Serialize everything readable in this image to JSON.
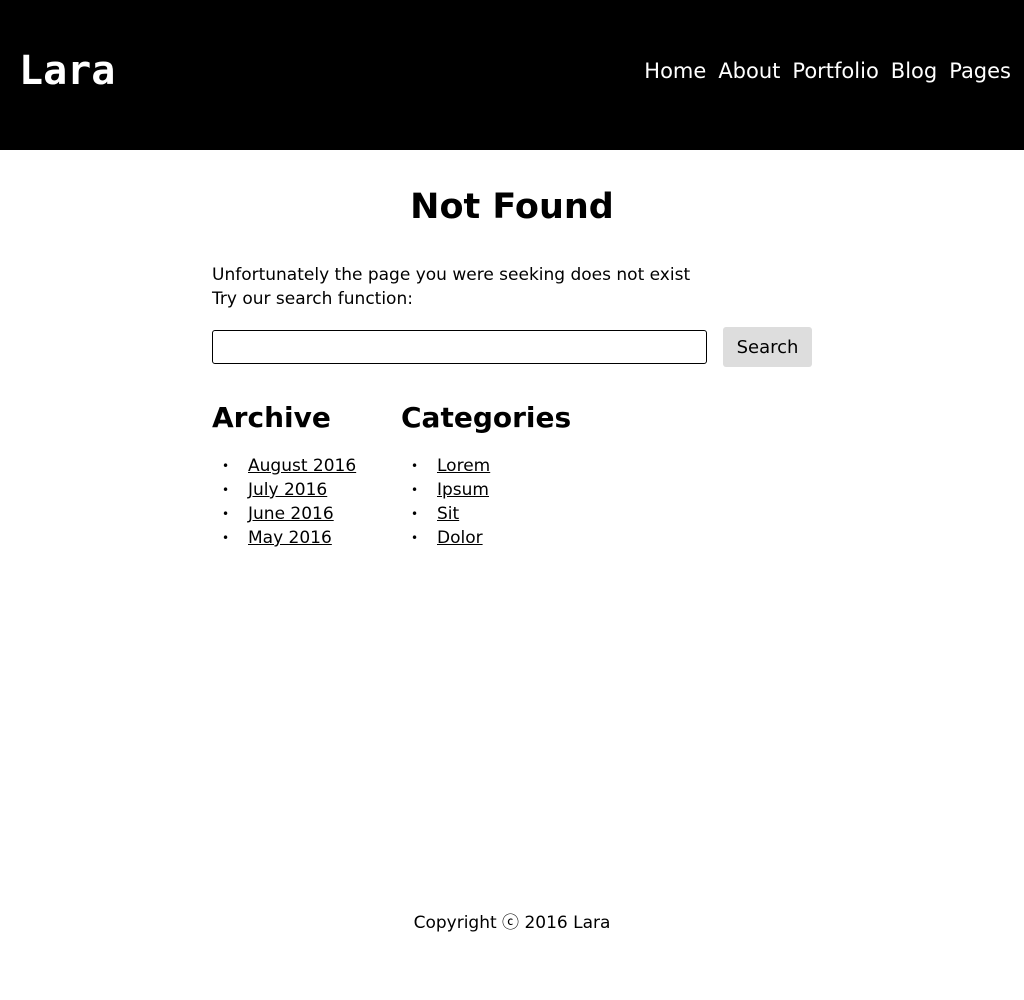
{
  "header": {
    "logo": "Lara",
    "nav": [
      "Home",
      "About",
      "Portfolio",
      "Blog",
      "Pages"
    ]
  },
  "main": {
    "title": "Not Found",
    "message_line1": "Unfortunately the page you were seeking does not exist",
    "message_line2": "Try our search function:",
    "search": {
      "value": "",
      "placeholder": "",
      "button_label": "Search"
    }
  },
  "archive": {
    "heading": "Archive",
    "items": [
      "August 2016",
      "July 2016",
      "June 2016",
      "May 2016"
    ]
  },
  "categories": {
    "heading": "Categories",
    "items": [
      "Lorem",
      "Ipsum",
      "Sit",
      "Dolor"
    ]
  },
  "footer": {
    "copyright": "Copyright ⓒ 2016 Lara"
  },
  "colors": {
    "header_bg": "#000000",
    "button_bg": "#dddddd"
  }
}
